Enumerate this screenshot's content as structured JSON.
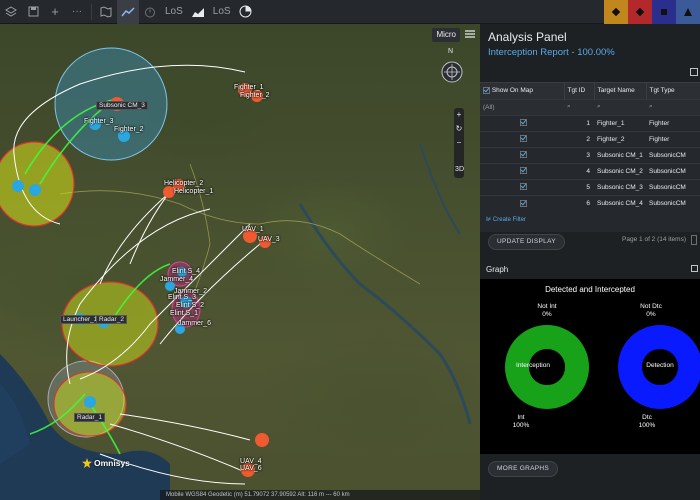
{
  "toolbar": {
    "items": [
      {
        "name": "save-icon"
      },
      {
        "name": "plus-icon",
        "glyph": "+"
      },
      {
        "name": "more-icon",
        "glyph": "···"
      },
      {
        "name": "map-edit-icon"
      },
      {
        "name": "line-chart-icon"
      },
      {
        "name": "timer-icon"
      },
      {
        "name": "los-label",
        "text": "LoS"
      },
      {
        "name": "area-chart-icon"
      },
      {
        "name": "los-label-2",
        "text": "LoS"
      },
      {
        "name": "dial-icon"
      }
    ],
    "tile_colors": [
      "#c2861f",
      "#b3282a",
      "#2a2e8c",
      "#3a5a9a"
    ]
  },
  "map": {
    "mode_label": "Micro",
    "compass_letter": "N",
    "zoom_plus": "+",
    "zoom_minus": "−",
    "view_3d": "3D",
    "logo_text": "Omnisys",
    "status_text": "Mobile   WGS84 Geodetic (m)    51.79072    37.90592    Alt: 116 m    ---    60 km",
    "labels": {
      "fighter_1": "Fighter_1",
      "fighter_2": "Fighter_2",
      "fighter_3": "Fighter_3",
      "fighter_2b": "Fighter_2",
      "subsonic_cm_3": "Subsonic CM_3",
      "helicopter_2": "Helicopter_2",
      "helicopter_1": "Helicopter_1",
      "uav_1": "UAV_1",
      "uav_3": "UAV_3",
      "uav_4": "UAV_4",
      "uav_6": "UAV_6",
      "elint_4": "Elint S_4",
      "elint_3": "Elint S_3",
      "elint_2": "Elint S_2",
      "elint_1": "Elint S_1",
      "jammer_4": "Jammer_4",
      "jammer_2": "Jammer_2",
      "jammer_6": "Jammer_6",
      "launcher_1": "Launcher_1",
      "radar_2": "Radar_2",
      "radar_1": "Radar_1"
    }
  },
  "panel": {
    "title": "Analysis Panel",
    "subtitle": "Interception Report - 100.00%",
    "table": {
      "headers": [
        "Show On Map",
        "Tgt ID",
        "Target Name",
        "Tgt Type"
      ],
      "filter_value": "(All)",
      "rows": [
        {
          "id": "1",
          "name": "Fighter_1",
          "type": "Fighter"
        },
        {
          "id": "2",
          "name": "Fighter_2",
          "type": "Fighter"
        },
        {
          "id": "3",
          "name": "Subsonic CM_1",
          "type": "SubsonicCM"
        },
        {
          "id": "4",
          "name": "Subsonic CM_2",
          "type": "SubsonicCM"
        },
        {
          "id": "5",
          "name": "Subsonic CM_3",
          "type": "SubsonicCM"
        },
        {
          "id": "6",
          "name": "Subsonic CM_4",
          "type": "SubsonicCM"
        }
      ]
    },
    "create_filter": "Create Filter",
    "update_button": "UPDATE DISPLAY",
    "pager": "Page 1 of 2 (14 items)",
    "graph_header": "Graph",
    "graph": {
      "title": "Detected and Intercepted",
      "left": {
        "top_label": "Not Int",
        "top_pct": "0%",
        "center": "Interception",
        "bottom_label": "Int",
        "bottom_pct": "100%",
        "color": "#17a21a",
        "fraction": 1.0
      },
      "right": {
        "top_label": "Not Dtc",
        "top_pct": "0%",
        "center": "Detection",
        "bottom_label": "Dtc",
        "bottom_pct": "100%",
        "color": "#0a1aff",
        "fraction": 1.0
      }
    },
    "more_graphs_button": "MORE GRAPHS"
  }
}
